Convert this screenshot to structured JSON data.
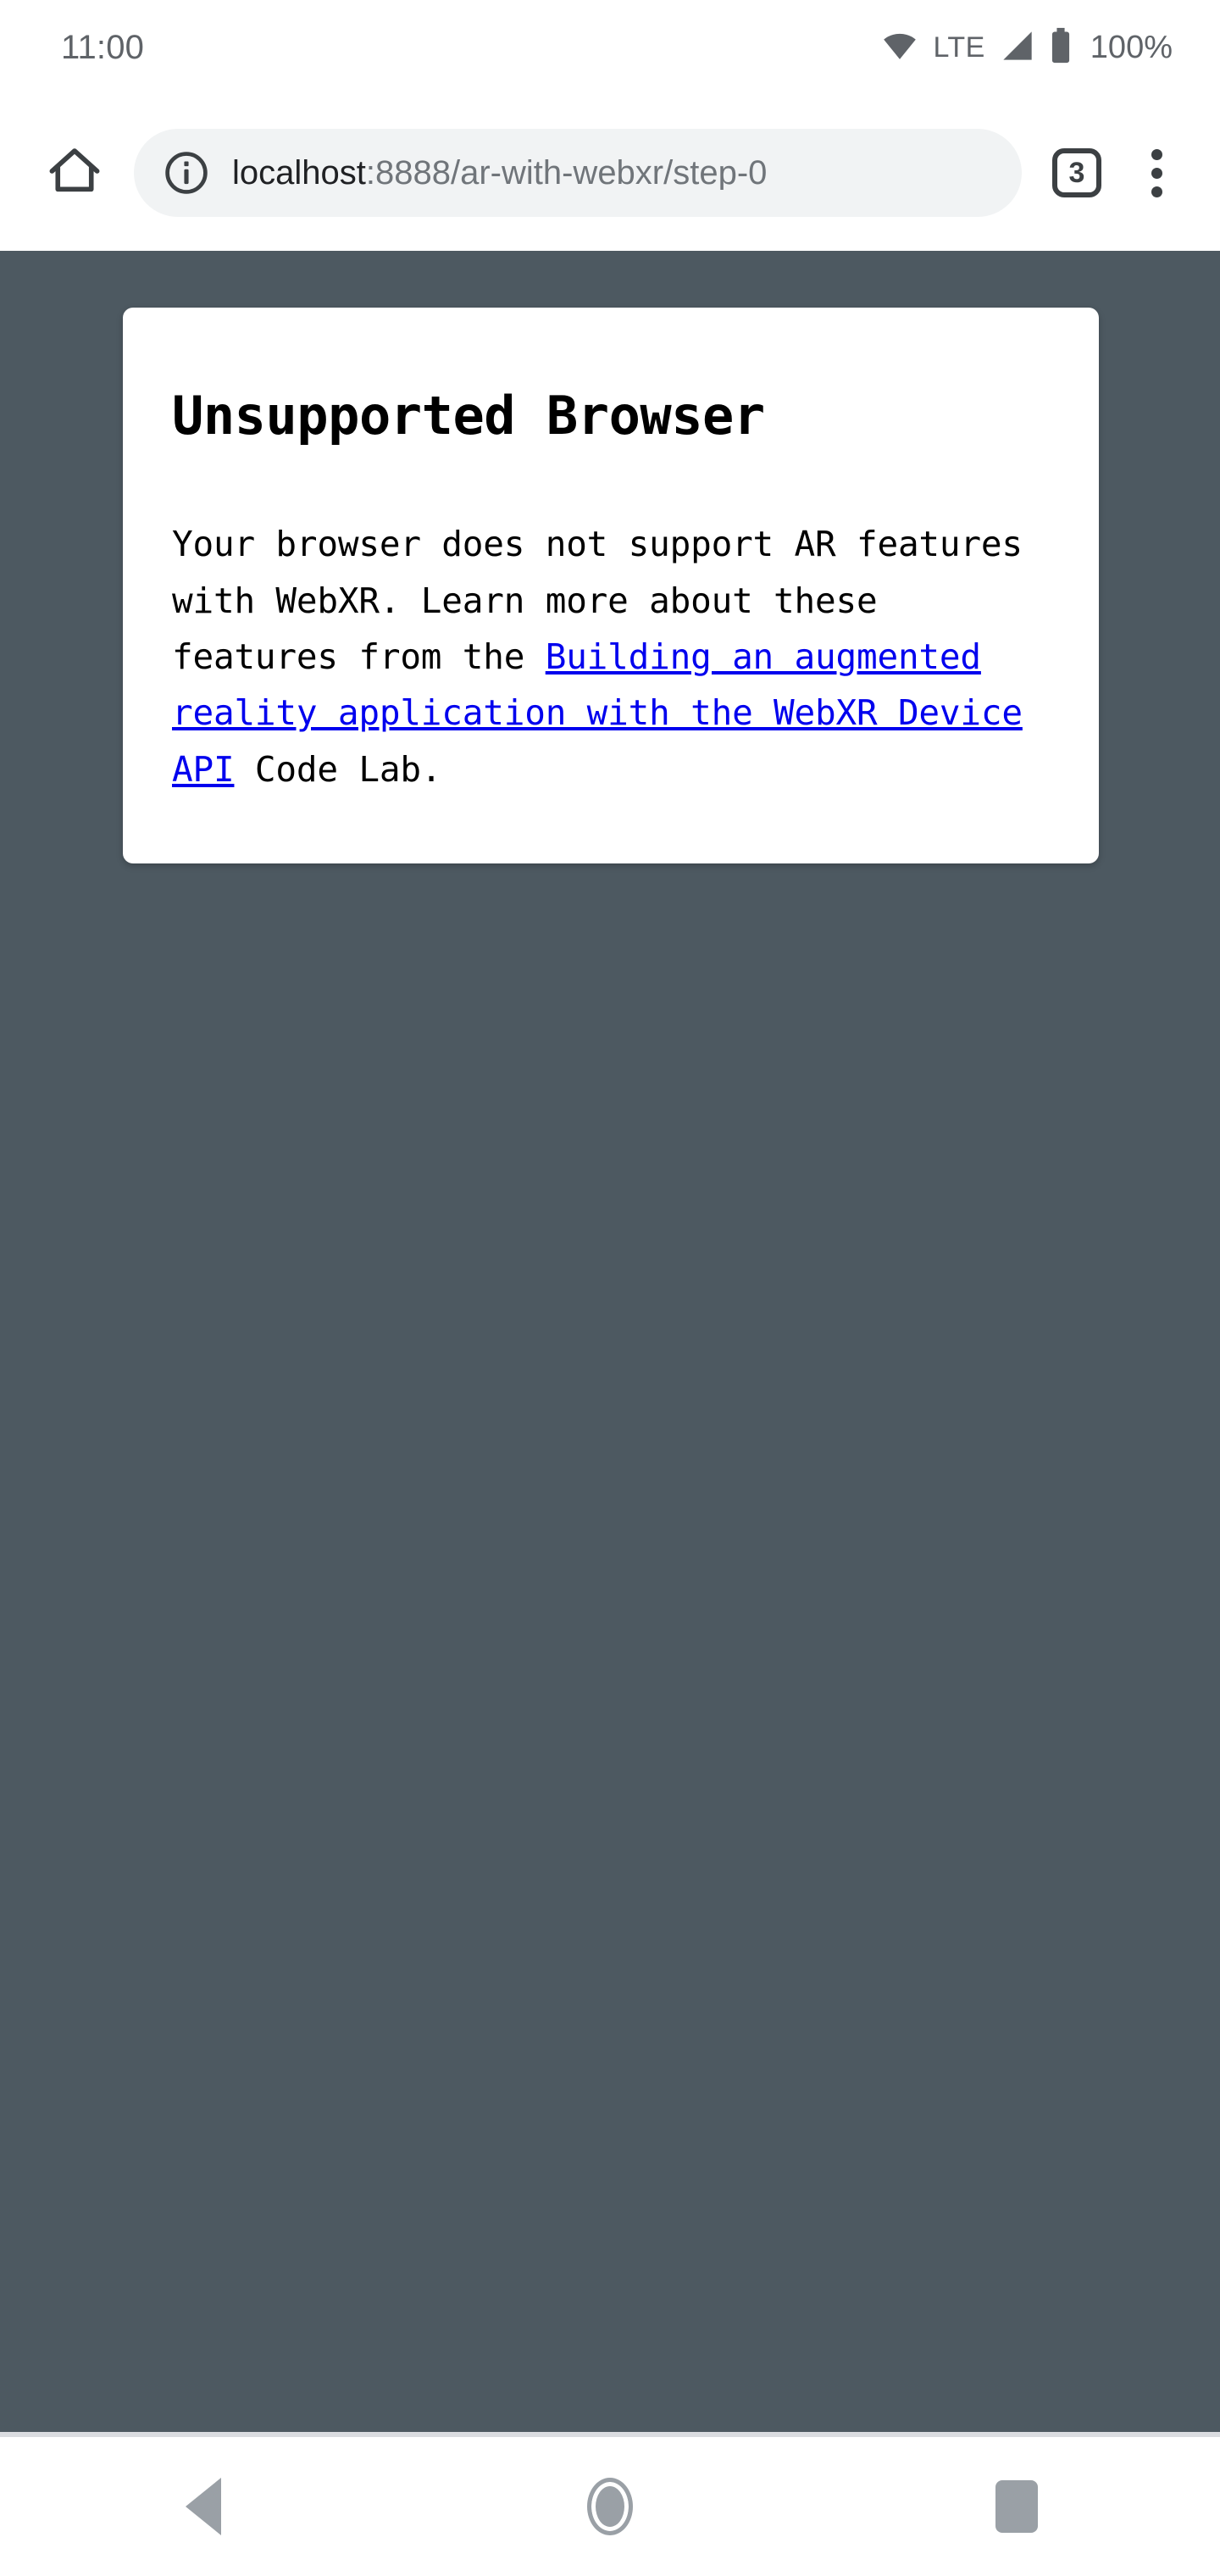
{
  "status_bar": {
    "clock": "11:00",
    "network_label": "LTE",
    "battery_percent": "100%",
    "icons": {
      "wifi": "wifi-icon",
      "signal": "cellular-signal-icon",
      "battery": "battery-icon"
    }
  },
  "browser": {
    "home_icon": "home-icon",
    "site_info_icon": "site-info-icon",
    "url_host": "localhost",
    "url_path": ":8888/ar-with-webxr/step-0",
    "url_full": "localhost:8888/ar-with-webxr/step-0",
    "tab_count": "3",
    "menu_icon": "overflow-menu-icon"
  },
  "page": {
    "background_color": "#4d5961",
    "card": {
      "title": "Unsupported Browser",
      "body_before_link": "Your browser does not support AR features with WebXR. Learn more about these features from the ",
      "link_text": "Building an augmented reality application with the WebXR Device API",
      "body_after_link": " Code Lab.",
      "link_color": "#0000ee"
    }
  },
  "nav_bar": {
    "back_label": "back-button",
    "home_label": "home-button",
    "recents_label": "recents-button"
  }
}
